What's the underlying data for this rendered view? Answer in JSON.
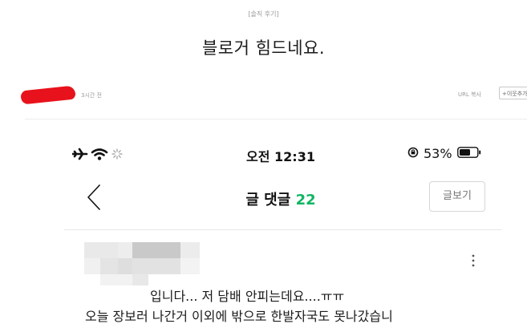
{
  "blog_post": {
    "category": "[솔직 후기]",
    "title": "블로거 힘드네요.",
    "time_ago": "3시간 전",
    "url_copy": "URL 복사",
    "neighbor_button": "+이웃추가"
  },
  "phone_screenshot": {
    "status_bar": {
      "time": "오전 12:31",
      "battery": "53%"
    },
    "header": {
      "title": "글 댓글",
      "comment_count": "22",
      "view_post_button": "글보기"
    },
    "comment": {
      "line1": "입니다... 저 담배 안피는데요....ㅠㅠ",
      "line2": "오늘 장보러 나간거 이외에 밖으로 한발자국도 못나갔습니"
    }
  },
  "colors": {
    "accent_green": "#12b564",
    "redaction_red": "#e8121c"
  }
}
